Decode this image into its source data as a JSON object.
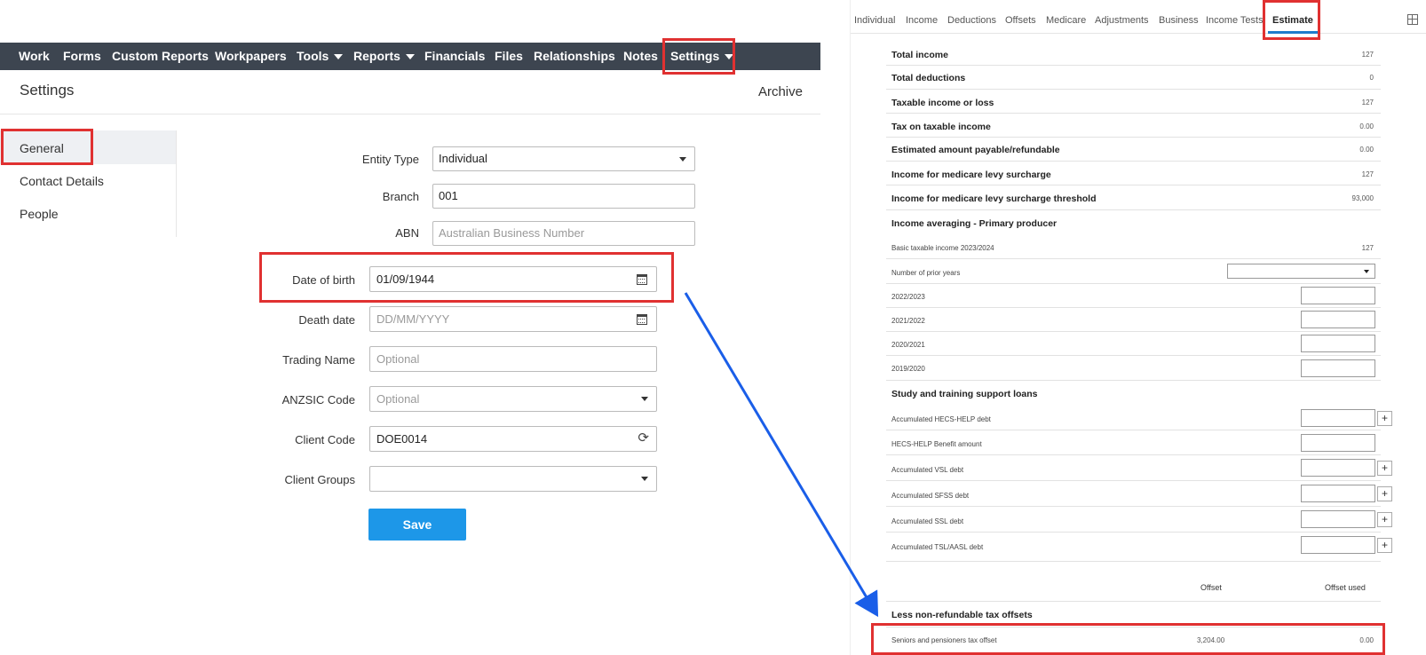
{
  "topnav": {
    "items": [
      "Work",
      "Forms",
      "Custom Reports",
      "Workpapers",
      "Tools",
      "Reports",
      "Financials",
      "Files",
      "Relationships",
      "Notes",
      "Settings"
    ]
  },
  "settings_page": {
    "title": "Settings",
    "archive": "Archive",
    "sidebar": [
      "General",
      "Contact Details",
      "People"
    ],
    "entity_type_label": "Entity Type",
    "entity_type_value": "Individual",
    "branch_label": "Branch",
    "branch_value": "001",
    "abn_label": "ABN",
    "abn_placeholder": "Australian Business Number"
  },
  "form": {
    "dob_label": "Date of birth",
    "dob_value": "01/09/1944",
    "death_label": "Death date",
    "death_placeholder": "DD/MM/YYYY",
    "trading_label": "Trading Name",
    "trading_placeholder": "Optional",
    "anzsic_label": "ANZSIC Code",
    "anzsic_placeholder": "Optional",
    "client_code_label": "Client Code",
    "client_code_value": "DOE0014",
    "client_groups_label": "Client Groups",
    "client_groups_value": "",
    "save_label": "Save"
  },
  "estimate": {
    "tabs": [
      "Individual",
      "Income",
      "Deductions",
      "Offsets",
      "Medicare",
      "Adjustments",
      "Business",
      "Income Tests",
      "Estimate"
    ],
    "active_tab": "Estimate",
    "summary_rows": [
      {
        "label": "Total income",
        "value": "127"
      },
      {
        "label": "Total deductions",
        "value": "0"
      },
      {
        "label": "Taxable income or loss",
        "value": "127"
      },
      {
        "label": "Tax on taxable income",
        "value": "0.00"
      },
      {
        "label": "Estimated amount payable/refundable",
        "value": "0.00"
      },
      {
        "label": "Income for medicare levy surcharge",
        "value": "127"
      },
      {
        "label": "Income for medicare levy surcharge threshold",
        "value": "93,000"
      }
    ],
    "income_averaging_heading": "Income averaging - Primary producer",
    "basic_taxable_label": "Basic taxable income 2023/2024",
    "basic_taxable_value": "127",
    "prior_years_label": "Number of prior years",
    "years": [
      "2022/2023",
      "2021/2022",
      "2020/2021",
      "2019/2020"
    ],
    "study_heading": "Study and training support loans",
    "loans": [
      {
        "label": "Accumulated HECS-HELP debt",
        "plus": true
      },
      {
        "label": "HECS-HELP Benefit amount",
        "plus": false
      },
      {
        "label": "Accumulated VSL debt",
        "plus": true
      },
      {
        "label": "Accumulated SFSS debt",
        "plus": true
      },
      {
        "label": "Accumulated SSL debt",
        "plus": true
      },
      {
        "label": "Accumulated TSL/AASL debt",
        "plus": true
      }
    ],
    "offset_col": "Offset",
    "offset_used_col": "Offset used",
    "offsets_heading": "Less non-refundable tax offsets",
    "seniors_label": "Seniors and pensioners tax offset",
    "seniors_offset": "3,204.00",
    "seniors_used": "0.00"
  },
  "colors": {
    "nav_bg": "#3d4550",
    "highlight": "#e03131",
    "arrow": "#1a5ee8",
    "save_button": "#1d97e8",
    "active_tab_underline": "#1e7ccc"
  }
}
